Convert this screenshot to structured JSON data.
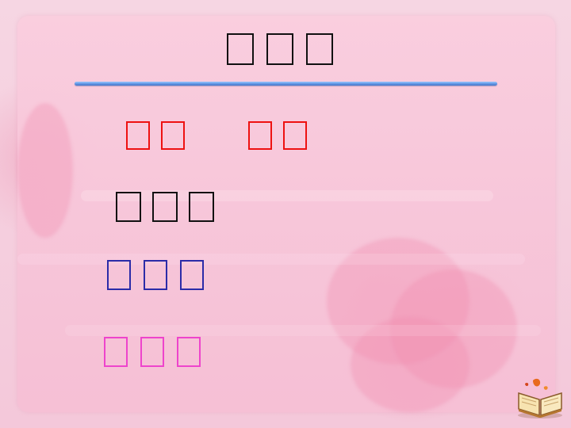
{
  "slide": {
    "title": "□□□",
    "lines": [
      {
        "words": [
          "□□",
          "□□"
        ],
        "color": "#ee1111"
      },
      {
        "words": [
          "□□□"
        ],
        "color": "#111111"
      },
      {
        "words": [
          "□□□"
        ],
        "color": "#2b2ba8"
      },
      {
        "words": [
          "□□□"
        ],
        "color": "#ee44cc"
      }
    ],
    "colors": {
      "background": "#f6d6e3",
      "panel": "#f8c9dc",
      "divider": "#5b8fe0"
    },
    "icons": {
      "corner_icon": "open-book-icon"
    }
  }
}
